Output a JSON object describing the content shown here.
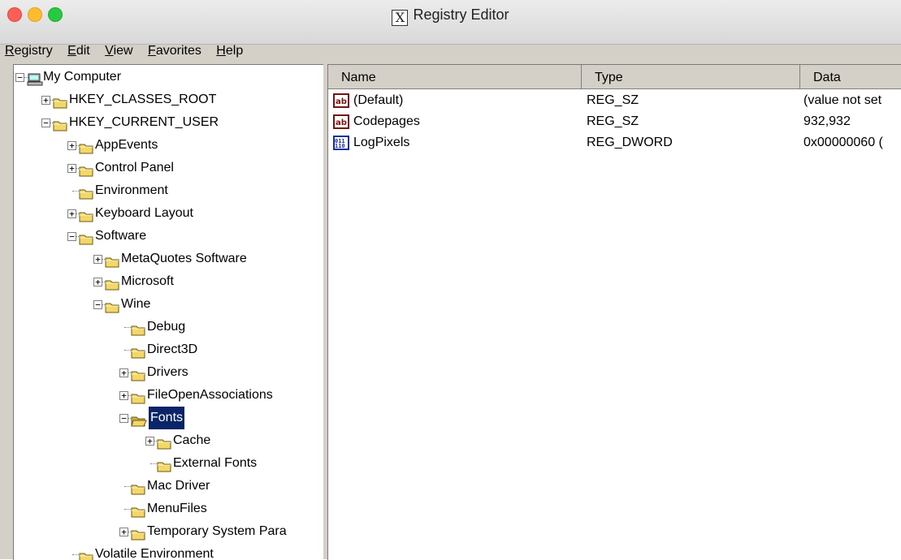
{
  "window": {
    "title": "Registry Editor",
    "x_icon": "X"
  },
  "menu": [
    {
      "label": "Registry",
      "accel": "R",
      "rest": "egistry"
    },
    {
      "label": "Edit",
      "accel": "E",
      "rest": "dit"
    },
    {
      "label": "View",
      "accel": "V",
      "rest": "iew"
    },
    {
      "label": "Favorites",
      "accel": "F",
      "rest": "avorites"
    },
    {
      "label": "Help",
      "accel": "H",
      "rest": "elp"
    }
  ],
  "tree": [
    {
      "label": "My Computer",
      "level": 0,
      "expander": "−",
      "icon": "computer-icon"
    },
    {
      "label": "HKEY_CLASSES_ROOT",
      "level": 1,
      "expander": "+",
      "icon": "folder-icon"
    },
    {
      "label": "HKEY_CURRENT_USER",
      "level": 1,
      "expander": "−",
      "icon": "folder-icon"
    },
    {
      "label": "AppEvents",
      "level": 2,
      "expander": "+",
      "icon": "folder-icon"
    },
    {
      "label": "Control Panel",
      "level": 2,
      "expander": "+",
      "icon": "folder-icon"
    },
    {
      "label": "Environment",
      "level": 2,
      "expander": "",
      "icon": "folder-icon"
    },
    {
      "label": "Keyboard Layout",
      "level": 2,
      "expander": "+",
      "icon": "folder-icon"
    },
    {
      "label": "Software",
      "level": 2,
      "expander": "−",
      "icon": "folder-icon"
    },
    {
      "label": "MetaQuotes Software",
      "level": 3,
      "expander": "+",
      "icon": "folder-icon"
    },
    {
      "label": "Microsoft",
      "level": 3,
      "expander": "+",
      "icon": "folder-icon"
    },
    {
      "label": "Wine",
      "level": 3,
      "expander": "−",
      "icon": "folder-icon"
    },
    {
      "label": "Debug",
      "level": 4,
      "expander": "",
      "icon": "folder-icon"
    },
    {
      "label": "Direct3D",
      "level": 4,
      "expander": "",
      "icon": "folder-icon"
    },
    {
      "label": "Drivers",
      "level": 4,
      "expander": "+",
      "icon": "folder-icon"
    },
    {
      "label": "FileOpenAssociations",
      "level": 4,
      "expander": "+",
      "icon": "folder-icon"
    },
    {
      "label": "Fonts",
      "level": 4,
      "expander": "−",
      "icon": "open-folder-icon",
      "selected": true
    },
    {
      "label": "Cache",
      "level": 5,
      "expander": "+",
      "icon": "folder-icon"
    },
    {
      "label": "External Fonts",
      "level": 5,
      "expander": "",
      "icon": "folder-icon"
    },
    {
      "label": "Mac Driver",
      "level": 4,
      "expander": "",
      "icon": "folder-icon"
    },
    {
      "label": "MenuFiles",
      "level": 4,
      "expander": "",
      "icon": "folder-icon"
    },
    {
      "label": "Temporary System Para",
      "level": 4,
      "expander": "+",
      "icon": "folder-icon"
    },
    {
      "label": "Volatile Environment",
      "level": 2,
      "expander": "",
      "icon": "folder-icon"
    }
  ],
  "list": {
    "columns": [
      "Name",
      "Type",
      "Data"
    ],
    "rows": [
      {
        "name": "(Default)",
        "type": "REG_SZ",
        "data": "(value not set",
        "icon": "string-value-icon"
      },
      {
        "name": "Codepages",
        "type": "REG_SZ",
        "data": "932,932",
        "icon": "string-value-icon"
      },
      {
        "name": "LogPixels",
        "type": "REG_DWORD",
        "data": "0x00000060 (",
        "icon": "binary-value-icon"
      }
    ]
  },
  "colors": {
    "selection": "#0a246a",
    "folder": "#f3d769",
    "chrome": "#d4d0c8"
  }
}
